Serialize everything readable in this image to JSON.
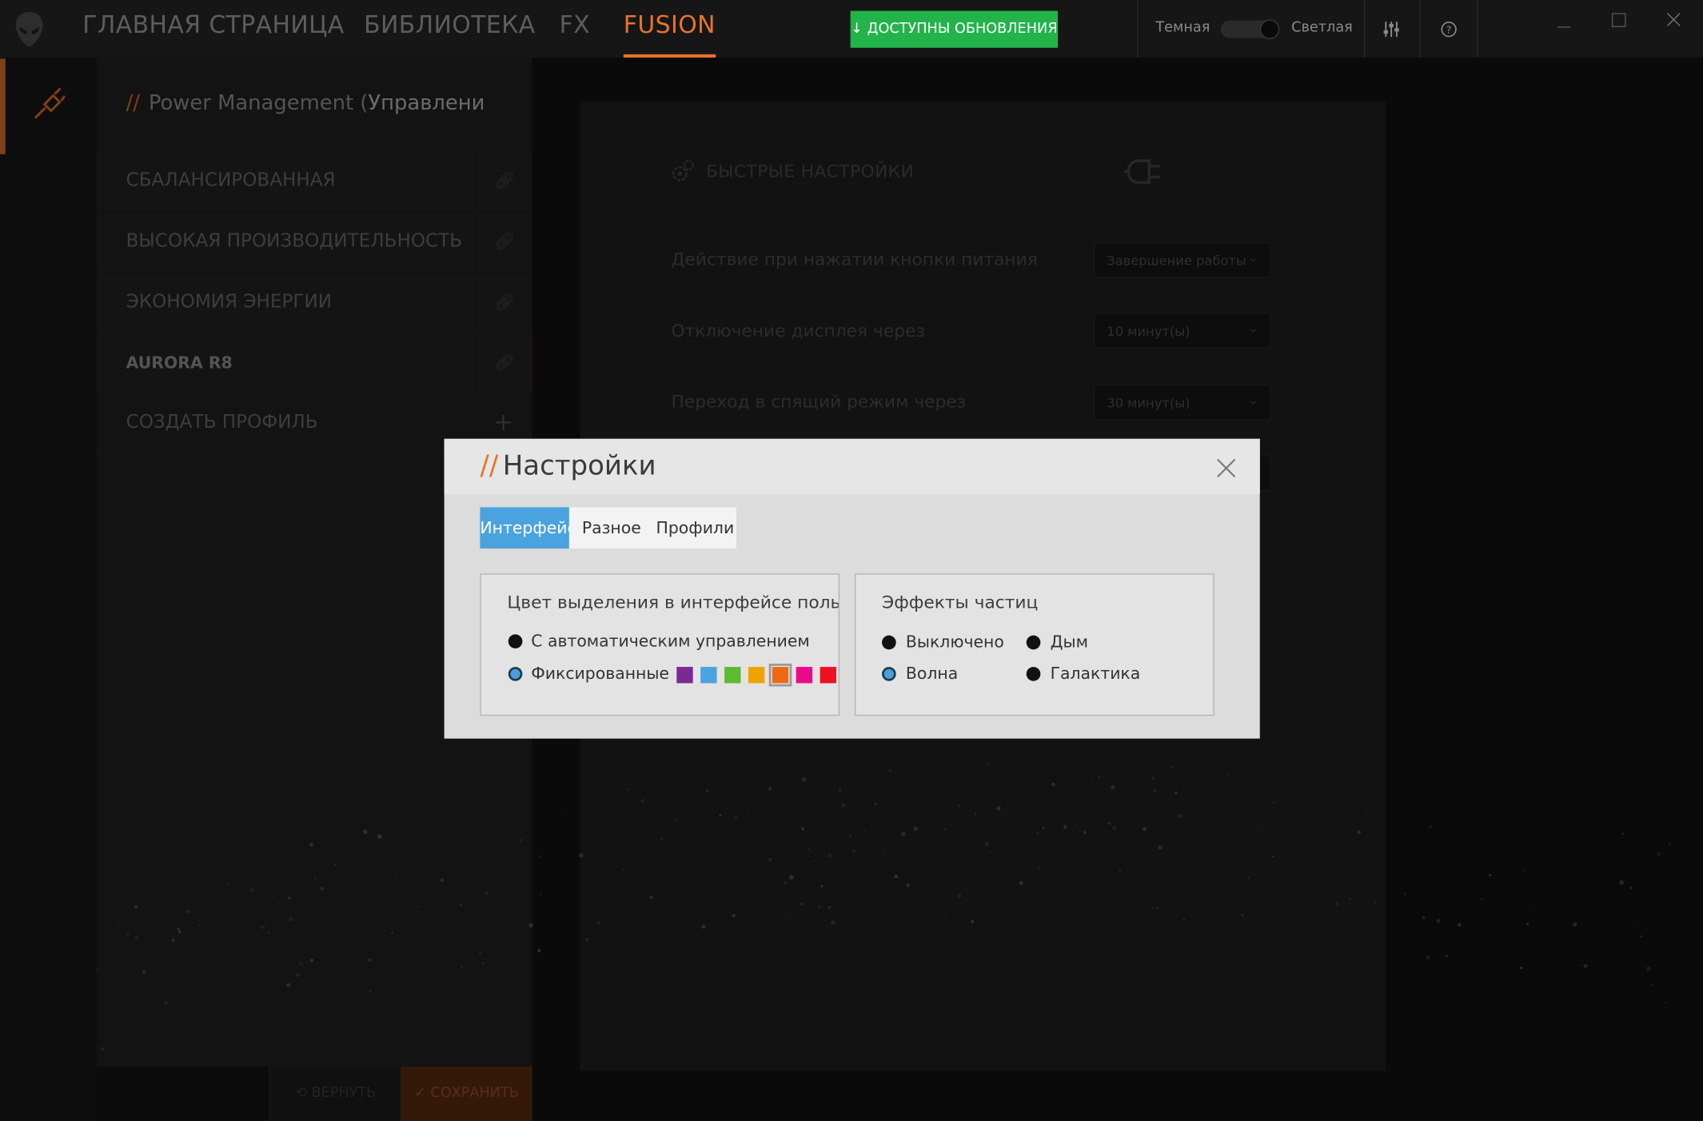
{
  "colors": {
    "accent": "#e8732b",
    "update_green": "#22b34a",
    "tab_active": "#4aa3de"
  },
  "nav": {
    "tabs": [
      {
        "label": "ГЛАВНАЯ СТРАНИЦА"
      },
      {
        "label": "БИБЛИОТЕКА"
      },
      {
        "label": "FX"
      },
      {
        "label": "FUSION"
      }
    ],
    "active_tab": "FUSION",
    "updates_label": "↓ ДОСТУПНЫ ОБНОВЛЕНИЯ",
    "theme_dark_label": "Темная",
    "theme_light_label": "Светлая",
    "icons": [
      "alien-logo-icon",
      "sliders-icon",
      "help-icon",
      "minimize-icon",
      "maximize-icon",
      "close-icon"
    ]
  },
  "sidebar": {
    "section_icon": "power-plug-icon",
    "slashes": "//",
    "title_plain": "Power Management (",
    "title_bold": "Управление эн",
    "profiles": [
      {
        "label": "СБАЛАНСИРОВАННАЯ",
        "icon": "link-icon"
      },
      {
        "label": "ВЫСОКАЯ ПРОИЗВОДИТЕЛЬНОСТЬ",
        "icon": "link-icon"
      },
      {
        "label": "ЭКОНОМИЯ ЭНЕРГИИ",
        "icon": "link-icon"
      },
      {
        "label": "AURORA R8",
        "icon": "link-icon",
        "selected": true
      }
    ],
    "create_label": "СОЗДАТЬ ПРОФИЛЬ",
    "create_icon": "plus-icon",
    "revert_label": "⟲ ВЕРНУТЬ",
    "save_label": "✓ СОХРАНИТЬ"
  },
  "quick_settings": {
    "title": "БЫСТРЫЕ НАСТРОЙКИ",
    "icons": [
      "gears-icon",
      "plug-icon"
    ],
    "rows": [
      {
        "label": "Действие при нажатии кнопки питания",
        "value": "Завершение работы"
      },
      {
        "label": "Отключение дисплея через",
        "value": "10 минут(ы)"
      },
      {
        "label": "Переход в спящий режим через",
        "value": "30 минут(ы)"
      }
    ]
  },
  "modal": {
    "slashes": "//",
    "title": "Настройки",
    "tabs": [
      {
        "label": "Интерфейс",
        "active": true
      },
      {
        "label": "Разное"
      },
      {
        "label": "Профили"
      }
    ],
    "highlight": {
      "title": "Цвет выделения в интерфейсе пользо",
      "auto_label": "С автоматическим управлением",
      "fixed_label": "Фиксированные",
      "selected": "fixed",
      "swatches": [
        "#7a2a92",
        "#4aa3de",
        "#5dbb2f",
        "#f0a300",
        "#ee6a12",
        "#ec0a8c",
        "#ee1122"
      ],
      "selected_swatch": "#ee6a12"
    },
    "particles": {
      "title": "Эффекты частиц",
      "options": [
        "Выключено",
        "Дым",
        "Волна",
        "Галактика"
      ],
      "selected": "Волна"
    }
  }
}
